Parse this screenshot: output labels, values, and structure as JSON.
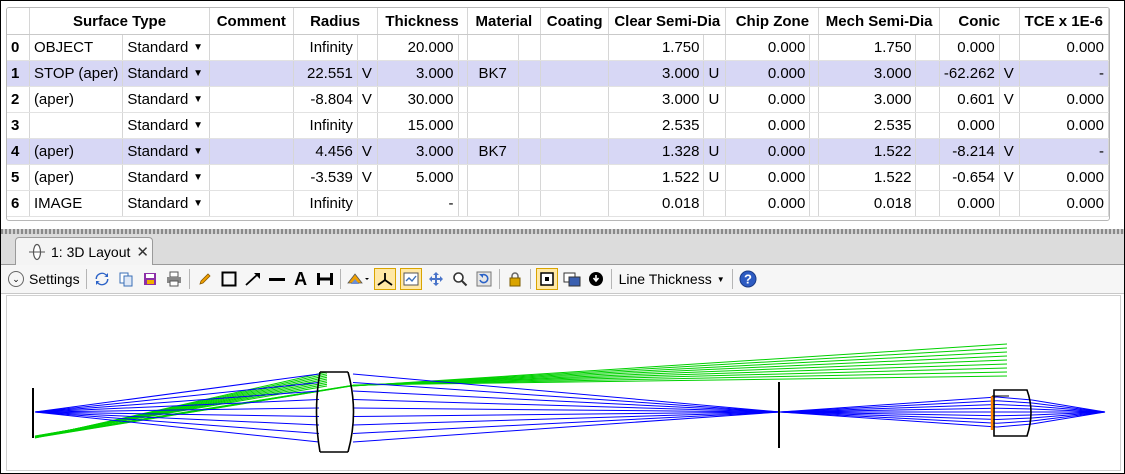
{
  "table": {
    "columns": [
      "",
      "Surface Type",
      "",
      "Comment",
      "Radius",
      "",
      "Thickness",
      "",
      "Material",
      "",
      "Coating",
      "Clear Semi-Dia",
      "",
      "Chip Zone",
      "",
      "Mech Semi-Dia",
      "",
      "Conic",
      "",
      "TCE x 1E-6"
    ],
    "rows": [
      {
        "num": "0",
        "comment_label": "OBJECT",
        "type": "Standard",
        "comment": "",
        "radius": "Infinity",
        "radius_flag": "",
        "thickness": "20.000",
        "thickness_flag": "",
        "material": "",
        "coating": "",
        "clear": "1.750",
        "clear_flag": "",
        "chip": "0.000",
        "mech": "1.750",
        "conic": "0.000",
        "conic_flag": "",
        "tce": "0.000"
      },
      {
        "num": "1",
        "comment_label": "STOP (aper)",
        "type": "Standard",
        "comment": "",
        "radius": "22.551",
        "radius_flag": "V",
        "thickness": "3.000",
        "thickness_flag": "",
        "material": "BK7",
        "coating": "",
        "clear": "3.000",
        "clear_flag": "U",
        "chip": "0.000",
        "mech": "3.000",
        "conic": "-62.262",
        "conic_flag": "V",
        "tce": "-"
      },
      {
        "num": "2",
        "comment_label": "(aper)",
        "type": "Standard",
        "comment": "",
        "radius": "-8.804",
        "radius_flag": "V",
        "thickness": "30.000",
        "thickness_flag": "",
        "material": "",
        "coating": "",
        "clear": "3.000",
        "clear_flag": "U",
        "chip": "0.000",
        "mech": "3.000",
        "conic": "0.601",
        "conic_flag": "V",
        "tce": "0.000"
      },
      {
        "num": "3",
        "comment_label": "",
        "type": "Standard",
        "comment": "",
        "radius": "Infinity",
        "radius_flag": "",
        "thickness": "15.000",
        "thickness_flag": "",
        "material": "",
        "coating": "",
        "clear": "2.535",
        "clear_flag": "",
        "chip": "0.000",
        "mech": "2.535",
        "conic": "0.000",
        "conic_flag": "",
        "tce": "0.000"
      },
      {
        "num": "4",
        "comment_label": "(aper)",
        "type": "Standard",
        "comment": "",
        "radius": "4.456",
        "radius_flag": "V",
        "thickness": "3.000",
        "thickness_flag": "",
        "material": "BK7",
        "coating": "",
        "clear": "1.328",
        "clear_flag": "U",
        "chip": "0.000",
        "mech": "1.522",
        "conic": "-8.214",
        "conic_flag": "V",
        "tce": "-"
      },
      {
        "num": "5",
        "comment_label": "(aper)",
        "type": "Standard",
        "comment": "",
        "radius": "-3.539",
        "radius_flag": "V",
        "thickness": "5.000",
        "thickness_flag": "",
        "material": "",
        "coating": "",
        "clear": "1.522",
        "clear_flag": "U",
        "chip": "0.000",
        "mech": "1.522",
        "conic": "-0.654",
        "conic_flag": "V",
        "tce": "0.000"
      },
      {
        "num": "6",
        "comment_label": "IMAGE",
        "type": "Standard",
        "comment": "",
        "radius": "Infinity",
        "radius_flag": "",
        "thickness": "-",
        "thickness_flag": "",
        "material": "",
        "coating": "",
        "clear": "0.018",
        "clear_flag": "",
        "chip": "0.000",
        "mech": "0.018",
        "conic": "0.000",
        "conic_flag": "",
        "tce": "0.000"
      }
    ],
    "selected_rows": [
      "1",
      "4"
    ]
  },
  "tab": {
    "label": "1: 3D Layout",
    "close": "✕"
  },
  "toolbar": {
    "settings_label": "Settings",
    "line_thickness_label": "Line Thickness",
    "text_tool": "A",
    "help": "?"
  },
  "colors": {
    "selected_row": "#d7d7f5",
    "ray_blue": "#0000ff",
    "ray_green": "#00d000",
    "surface_black": "#000000",
    "surface_orange": "#ff8000",
    "toolbar_active": "#ffe8a6"
  }
}
